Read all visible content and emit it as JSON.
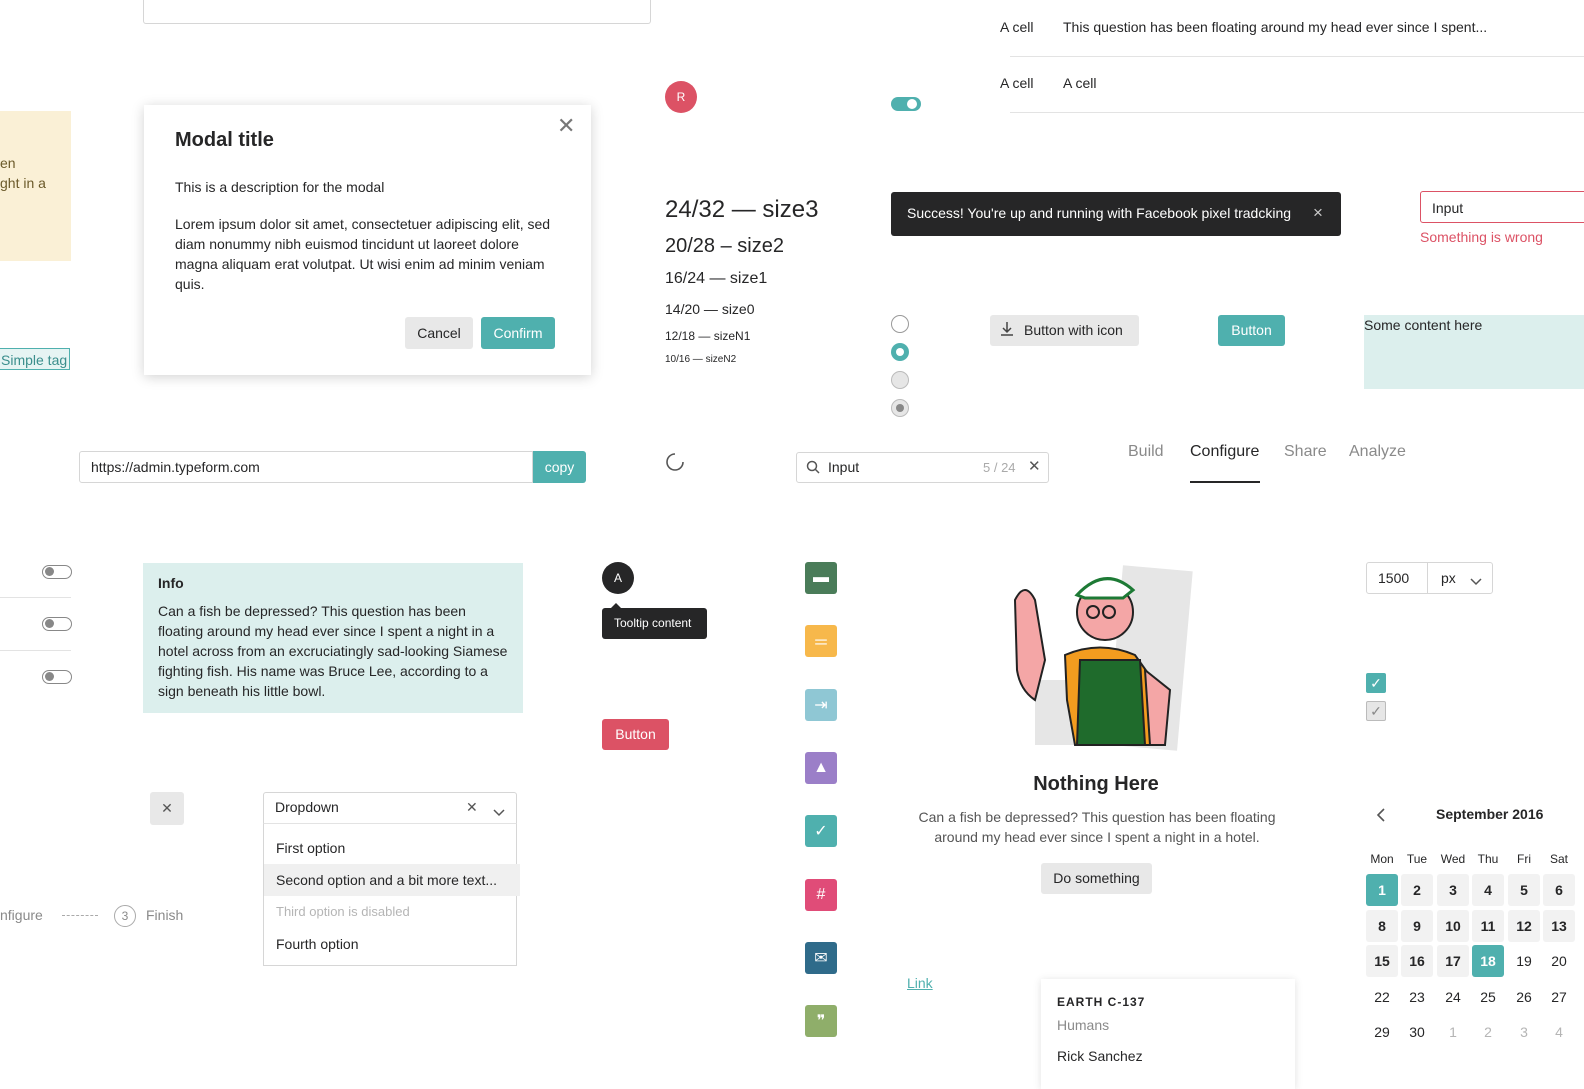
{
  "table": {
    "rows": [
      {
        "c1": "A cell",
        "c2": "This question has been floating around my head ever since I spent..."
      },
      {
        "c1": "A cell",
        "c2": "A cell"
      }
    ]
  },
  "left_note": {
    "lines": [
      "en",
      "ght in a",
      "",
      ""
    ]
  },
  "simple_tag": "Simple tag",
  "modal": {
    "title": "Modal title",
    "description": "This is a description for the modal",
    "body": "Lorem ipsum dolor sit amet, consectetuer adipiscing elit, sed diam nonummy nibh euismod tincidunt ut laoreet dolore magna aliquam erat volutpat. Ut wisi enim ad minim veniam quis.",
    "cancel": "Cancel",
    "confirm": "Confirm"
  },
  "avatar_r": "R",
  "avatar_a": "A",
  "type_sizes": [
    "24/32 — size3",
    "20/28 – size2",
    "16/24 — size1",
    "14/20 — size0",
    "12/18 — sizeN1",
    "10/16 — sizeN2"
  ],
  "toast": {
    "text": "Success! You're up and running with Facebook pixel tradcking",
    "close": "×"
  },
  "error_input": {
    "value": "Input",
    "error": "Something is wrong"
  },
  "buttons": {
    "with_icon": "Button with icon",
    "teal": "Button",
    "red": "Button"
  },
  "content_box": "Some content here",
  "url_copy": {
    "value": "https://admin.typeform.com",
    "copy": "copy"
  },
  "search": {
    "value": "Input",
    "counter": "5 / 24"
  },
  "tabs": [
    "Build",
    "Configure",
    "Share",
    "Analyze"
  ],
  "active_tab": "Configure",
  "info": {
    "title": "Info",
    "body": "Can a fish be depressed? This question has been floating around my head ever since I spent a night in a hotel across from an excruciatingly sad-looking Siamese fighting fish. His name was Bruce Lee, according to a sign beneath his little bowl."
  },
  "tooltip": "Tooltip content",
  "unit_input": {
    "value": "1500",
    "unit": "px"
  },
  "empty_state": {
    "title": "Nothing Here",
    "body": "Can a fish be depressed? This question has been floating around my head ever since I spent a night in a hotel.",
    "action": "Do something"
  },
  "dropdown": {
    "value": "Dropdown",
    "options": [
      "First option",
      "Second option and a bit more text...",
      "Third option is disabled",
      "Fourth option"
    ]
  },
  "stepper": {
    "prev_label": "nfigure",
    "step_number": "3",
    "step_label": "Finish"
  },
  "link": "Link",
  "card": {
    "kicker": "EARTH C-137",
    "sub": "Humans",
    "name": "Rick Sanchez"
  },
  "calendar": {
    "month": "September 2016",
    "weekdays": [
      "Mon",
      "Tue",
      "Wed",
      "Thu",
      "Fri",
      "Sat"
    ],
    "rows": [
      [
        "1",
        "2",
        "3",
        "4",
        "5",
        "6"
      ],
      [
        "8",
        "9",
        "10",
        "11",
        "12",
        "13"
      ],
      [
        "15",
        "16",
        "17",
        "18",
        "19",
        "20"
      ],
      [
        "22",
        "23",
        "24",
        "25",
        "26",
        "27"
      ],
      [
        "29",
        "30",
        "1",
        "2",
        "3",
        "4"
      ]
    ],
    "selected": [
      "1",
      "18"
    ]
  },
  "colors": {
    "teal": "#4fb0ae",
    "red": "#dc5265",
    "dark": "#262627",
    "mint": "#dcefed",
    "cream": "#faf0d6"
  },
  "icons": [
    "section-icon",
    "short-text-icon",
    "jump-icon",
    "picture-icon",
    "check-icon",
    "number-icon",
    "email-icon",
    "quote-icon"
  ]
}
